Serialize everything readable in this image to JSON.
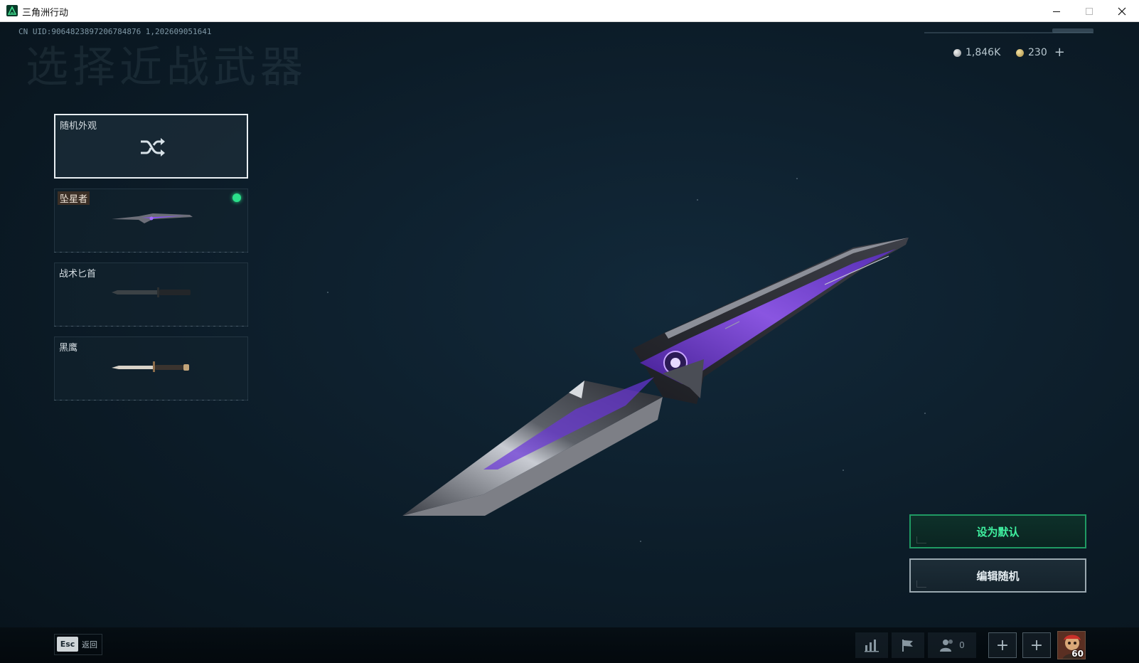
{
  "window": {
    "title": "三角洲行动",
    "minimize_icon": "minimize-icon",
    "maximize_icon": "maximize-icon",
    "close_icon": "close-icon"
  },
  "header": {
    "uid": "CN UID:9064823897206784876120260905164 1",
    "uid_display": "CN UID:9064823897206784876 1,202609051641",
    "page_title": "选择近战武器",
    "currency": [
      {
        "icon": "silver-coin-icon",
        "value": "1,846K"
      },
      {
        "icon": "gold-coin-icon",
        "value": "230"
      }
    ],
    "add_currency_icon": "plus-icon"
  },
  "weapon_list": [
    {
      "label": "随机外观",
      "icon": "shuffle-icon",
      "selected": true
    },
    {
      "label": "坠星者",
      "equipped": true,
      "equipped_color": "#2be08a"
    },
    {
      "label": "战术匕首"
    },
    {
      "label": "黑鹰"
    }
  ],
  "actions": {
    "set_default": "设为默认",
    "edit_random": "编辑随机"
  },
  "bottom_bar": {
    "esc_key": "Esc",
    "back": "返回",
    "friends_count": "0",
    "player_level": "60"
  },
  "colors": {
    "accent_green": "#3ff0a0",
    "blade_purple": "#7a3cff"
  }
}
